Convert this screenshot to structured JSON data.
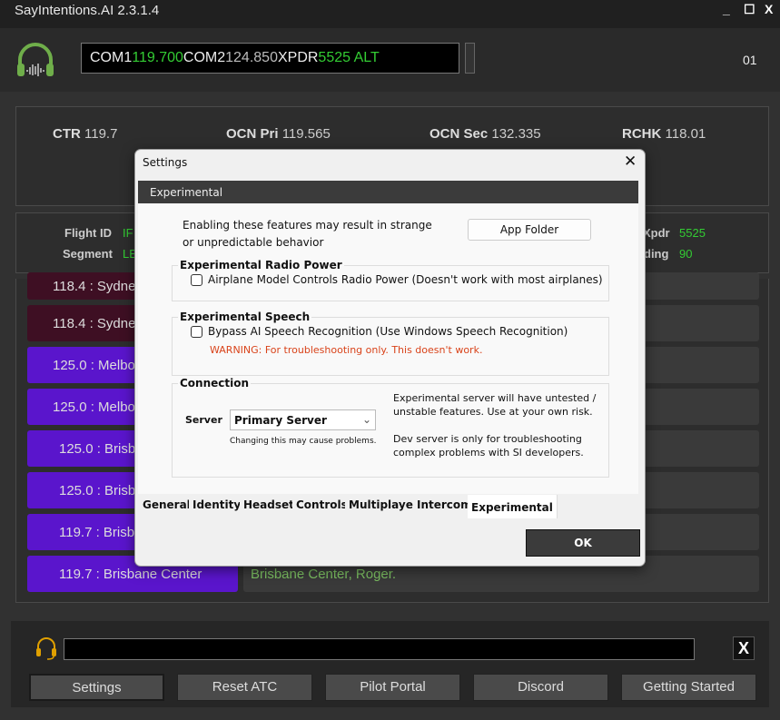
{
  "app": {
    "title": "SayIntentions.AI  2.3.1.4",
    "minimize": "_",
    "maximize": "☐",
    "close": "X"
  },
  "radio": {
    "com1_label": "COM1",
    "com1": "119.700",
    "com2_label": "COM2",
    "com2": "124.850",
    "xpdr_label": "XPDR",
    "xpdr": "5525 ALT",
    "counter": "01"
  },
  "frequencies": [
    {
      "label": "CTR",
      "value": "119.7"
    },
    {
      "label": "OCN Pri",
      "value": "119.565"
    },
    {
      "label": "OCN Sec",
      "value": "132.335"
    },
    {
      "label": "RCHK",
      "value": "118.01"
    }
  ],
  "flight_info": {
    "flight_id_label": "Flight ID",
    "flight_id": "IF",
    "segment_label": "Segment",
    "segment": "LE",
    "xpdr_label": "Xpdr",
    "xpdr": "5525",
    "heading_label": "ding",
    "heading": "90"
  },
  "messages": [
    {
      "station": "118.4 : Sydne",
      "text": "",
      "type": "red"
    },
    {
      "station": "118.4 : Sydne",
      "text": "",
      "type": "red"
    },
    {
      "station": "125.0 : Melbo",
      "text": "",
      "type": "purple"
    },
    {
      "station": "125.0 : Melbo",
      "text": "",
      "type": "purple"
    },
    {
      "station": "125.0 : Brisb",
      "text": "",
      "type": "purple"
    },
    {
      "station": "125.0 : Brisb",
      "text": "",
      "type": "purple"
    },
    {
      "station": "119.7 : Brisb",
      "text": "",
      "type": "purple"
    },
    {
      "station": "119.7 : Brisbane Center",
      "text": "Brisbane Center, Roger.",
      "type": "purple"
    }
  ],
  "settings": {
    "title": "Settings",
    "close": "✕",
    "section": "Experimental",
    "intro_line1": "Enabling these features may result in strange",
    "intro_line2": "or unpredictable behavior",
    "app_folder": "App Folder",
    "radio_power": {
      "legend": "Experimental Radio Power",
      "checkbox": "Airplane Model Controls Radio Power (Doesn't work with most airplanes)",
      "checked": false
    },
    "speech": {
      "legend": "Experimental Speech",
      "checkbox": "Bypass AI Speech Recognition (Use Windows Speech Recognition)",
      "checked": false,
      "warning": "WARNING: For troubleshooting only. This doesn't work."
    },
    "connection": {
      "legend": "Connection",
      "server_label": "Server",
      "server_value": "Primary Server",
      "server_hint": "Changing this may cause problems.",
      "note1_line1": "Experimental server will have untested /",
      "note1_line2": "unstable features. Use at your own risk.",
      "note2_line1": "Dev server is only for troubleshooting",
      "note2_line2": "complex problems with SI developers."
    },
    "tabs": [
      "General",
      "Identity",
      "Headset",
      "Controls",
      "Multiplayer",
      "Intercom",
      "Experimental"
    ],
    "active_tab": "Experimental",
    "ok": "OK"
  },
  "bottom": {
    "input_value": "",
    "clear": "X",
    "buttons": [
      "Settings",
      "Reset ATC",
      "Pilot Portal",
      "Discord",
      "Getting Started"
    ]
  },
  "colors": {
    "green": "#33cc33",
    "purple": "#5a15cc",
    "dark_red": "#3e0f23",
    "warning": "#d9431a",
    "headset": "#e0a000"
  }
}
